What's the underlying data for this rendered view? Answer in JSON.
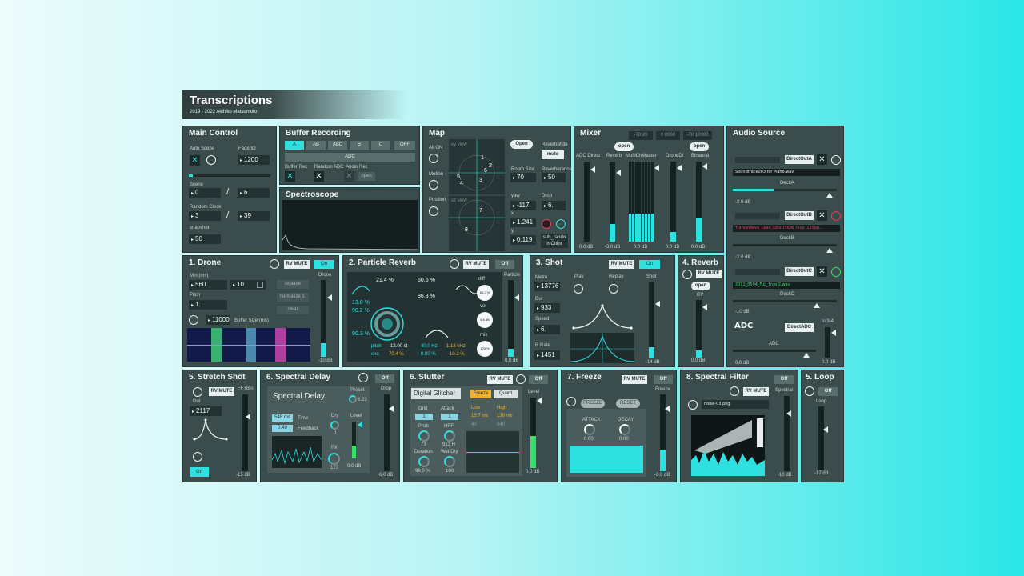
{
  "header": {
    "title": "Transcriptions",
    "subtitle": "2019 - 2022 Akihiko Matsumoto"
  },
  "colors": {
    "accent": "#2ee0e0",
    "panel": "#3a4c4c",
    "field": "#233232",
    "red": "#e0405a",
    "green": "#38e06a",
    "gold": "#f0b030"
  },
  "main_control": {
    "title": "Main Control",
    "auto_scene_label": "Auto Scene",
    "fade_io_label": "Fade IO",
    "fade_io": "1200",
    "scene_label": "Scene",
    "scene": "0",
    "scene_total": "6",
    "slash": "/",
    "random_clock_label": "Random Clock",
    "random_clock": "3",
    "random_clock_total": "39",
    "snapshot_label": "snapshot",
    "snapshot": "50",
    "progress": 0.05
  },
  "buffer_recording": {
    "title": "Buffer Recording",
    "buttons": [
      "A",
      "AB",
      "ABC",
      "B",
      "C",
      "OFF"
    ],
    "adc": "ADC",
    "buffer_rec_label": "Buffer Rec",
    "random_abc_label": "Random ABC",
    "audio_rec_label": "Audio Rec",
    "open": "open"
  },
  "spectroscope": {
    "title": "Spectroscope"
  },
  "map": {
    "title": "Map",
    "all_on": "All ON",
    "motion": "Motion",
    "position": "Position",
    "open": "Open",
    "reverb_mute_label": "ReverbMute",
    "mute": "mute",
    "room_size_label": "Room Size",
    "room_size": "70",
    "reverberance_label": "Reverberance",
    "reverberance": "50",
    "yaw_label": "yaw",
    "yaw": "-117.",
    "drop_label": "Drop",
    "drop": "6.",
    "x_label": "x",
    "x": "1.241",
    "y_label": "y",
    "y": "0.119",
    "sub_random_color": "sub_rando mColor",
    "dots": [
      "1",
      "2",
      "3",
      "4",
      "5",
      "6",
      "7",
      "8"
    ],
    "xy_view": "xy view",
    "xz_view": "xz view"
  },
  "mixer": {
    "title": "Mixer",
    "ranges": [
      "-70 20",
      "0 0000",
      "-70 10000"
    ],
    "open": "open",
    "channels": [
      {
        "label": "ADC Direct",
        "db": "0.0 dB",
        "level": 0.0
      },
      {
        "label": "Reverb",
        "db": "-3.0 dB",
        "level": 0.22
      },
      {
        "label": "MultiChMaster",
        "db": "0.0 dB",
        "level": 0.35
      },
      {
        "label": "DroneDi",
        "db": "0.0 dB",
        "level": 0.12
      },
      {
        "label": "Binaural",
        "db": "0.0 dB",
        "level": 0.3
      }
    ]
  },
  "audio_source": {
    "title": "Audio Source",
    "decks": [
      {
        "name": "DirectOutA",
        "file": "Soundtrack003 for Piano.wav",
        "deck": "DeckA",
        "db": "-2.0 dB",
        "progress": 0.4
      },
      {
        "name": "DirectOutB",
        "file": "TranceWave_Lead_DEVOTION_loop_135bp...",
        "deck": "DeckB",
        "db": "-2.0 dB",
        "progress": 0.0
      },
      {
        "name": "DirectOutC",
        "file": "2011_0504_Fuji_Frog 2.wav",
        "deck": "DeckC",
        "db": "-10 dB",
        "progress": 0.0
      }
    ],
    "adc_title": "ADC",
    "direct_adc": "DirectADC",
    "adc_label": "ADC",
    "in34": "in 3-4",
    "adc_db": "0.0 dB",
    "in_db": "0.0 dB"
  },
  "drone": {
    "title": "1. Drone",
    "rv_mute": "RV MUTE",
    "on": "On",
    "min_ms_label": "Min (ms)",
    "min_ms": "560",
    "max_val": "10",
    "pitch_label": "Pitch",
    "pitch": "1.",
    "buffer_size": "11000",
    "buffer_size_label": "Buffer Size (ms)",
    "replace": "replace",
    "normalize": "normalize 1.",
    "clear": "clear",
    "meter_label": "Drone",
    "db": "-10 dB",
    "level": 0.18
  },
  "particle_reverb": {
    "title": "2. Particle Reverb",
    "rv_mute": "RV MUTE",
    "off": "Off",
    "v1": "21.4 %",
    "v2": "60.5 %",
    "v3": "86.3 %",
    "v4": "13.0 %",
    "v5": "90.2 %",
    "v6": "90.3 %",
    "diff_label": "diff",
    "diff": "88.2 %",
    "vol_label": "vol",
    "vol": "6.8 dB",
    "mix_label": "mix",
    "mix": "100 %",
    "pitch_label": "pitch",
    "pitch": "-12.00 st",
    "pitch_pct": "70.4 %",
    "cho_label": "cho",
    "hz": "40.0 Hz",
    "hz_pct": "0.00 %",
    "khz": "1.18 kHz",
    "khz_pct": "10.2 %",
    "meter_label": "Particle",
    "db": "0.0 dB",
    "level": 0.1
  },
  "shot": {
    "title": "3. Shot",
    "rv_mute": "RV MUTE",
    "on": "On",
    "metro_label": "Metro",
    "metro": "13776",
    "dur_label": "Dur",
    "dur": "933",
    "speed_label": "Speed",
    "speed": "6.",
    "rrate_label": "R.Rate",
    "rrate": "1451",
    "play_label": "Play",
    "replay_label": "Replay",
    "meter_label": "Shot",
    "db": "-14 dB",
    "level": 0.15
  },
  "reverb": {
    "title": "4. Reverb",
    "rv_mute": "RV MUTE",
    "open": "open",
    "rv_label": "RV",
    "db": "0.0 dB",
    "level": 0.12
  },
  "stretch_shot": {
    "title": "5. Stretch Shot",
    "rv_mute": "RV MUTE",
    "dur_label": "Dur",
    "dur": "2117",
    "fftbin_label": "FFTBin",
    "db": "-15 dB",
    "on": "On",
    "level": 0.0
  },
  "spectral_delay": {
    "title": "6. Spectral Delay",
    "off": "Off",
    "name": "Spectral Delay",
    "preset_label": "Preset",
    "preset": "6.23",
    "time_val": "548 ms",
    "time_label": "Time",
    "feedback_val": "0.49",
    "feedback_label": "Feedback",
    "dry_label": "Dry",
    "dry": "0",
    "level_label": "Level",
    "fx_label": "FX",
    "fx": "127",
    "db": "0.0 dB",
    "drop_label": "Drop",
    "drop_db": "-6.0 dB",
    "level": 0.35
  },
  "stutter": {
    "title": "6. Stutter",
    "rv_mute": "RV MUTE",
    "off": "Off",
    "name": "Digital Glitcher",
    "freeze": "Freeze",
    "quant": "Quant",
    "grid_label": "Grid",
    "grid": "1",
    "attack_label": "Attack",
    "attack": "1",
    "low_label": "Low",
    "low": "15.7 ms",
    "low_sub": "4n",
    "high_label": "High",
    "high": "139 ms",
    "high_sub": "64n",
    "prob_label": "Prob",
    "prob": "73",
    "hpf_label": "HPF",
    "hpf": "913 H",
    "duration_label": "Duration",
    "duration": "99.0 %",
    "wetdry_label": "Wet/Dry",
    "wetdry": "100",
    "level_label": "Level",
    "db": "0.0 dB",
    "level": 0.45
  },
  "freeze": {
    "title": "7. Freeze",
    "rv_mute": "RV MUTE",
    "off": "Off",
    "freeze_btn": "FREEZE",
    "reset_btn": "RESET",
    "attack_label": "ATTACK",
    "attack": "0.00",
    "decay_label": "DECAY",
    "decay": "0.00",
    "meter_label": "Freeze",
    "db": "-6.0 dB",
    "level": 0.28
  },
  "spectral_filter": {
    "title": "8. Spectral Filter",
    "off": "Off",
    "rv_mute": "RV MUTE",
    "file": "noise-03.png",
    "meter_label": "Spectral",
    "db": "-10 dB",
    "level": 0.0
  },
  "loop": {
    "title": "5. Loop",
    "off": "Off",
    "meter_label": "Loop",
    "db": "-17 dB",
    "level": 0.0
  }
}
